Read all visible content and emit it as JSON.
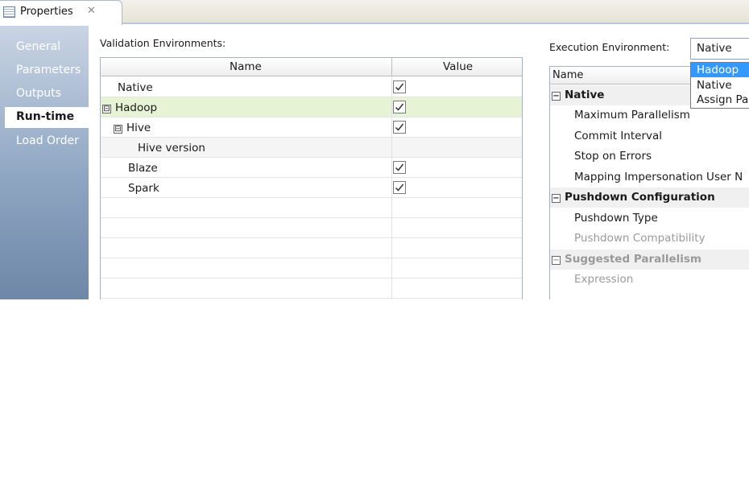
{
  "tab": {
    "title": "Properties",
    "close_glyph": "✕"
  },
  "nav": {
    "items": [
      {
        "label": "General",
        "active": false
      },
      {
        "label": "Parameters",
        "active": false
      },
      {
        "label": "Outputs",
        "active": false
      },
      {
        "label": "Run-time",
        "active": true
      },
      {
        "label": "Load Order",
        "active": false
      }
    ]
  },
  "validation": {
    "label": "Validation Environments:",
    "columns": [
      "Name",
      "Value"
    ],
    "rows": [
      {
        "name": "Native",
        "checked": true
      },
      {
        "name": "Hadoop",
        "checked": true,
        "expander": "⊟"
      },
      {
        "name": "Hive",
        "checked": true,
        "expander": "⊟"
      },
      {
        "name": "Hive version",
        "checked": false
      },
      {
        "name": "Blaze",
        "checked": true
      },
      {
        "name": "Spark",
        "checked": true
      }
    ]
  },
  "execution": {
    "label": "Execution Environment:",
    "selected": "Native",
    "dropdown_options": [
      "Hadoop",
      "Native",
      "Assign Pa"
    ],
    "highlighted_option": "Hadoop",
    "table_header": "Name",
    "rows": [
      {
        "name": "Native",
        "type": "group"
      },
      {
        "name": "Maximum Parallelism",
        "type": "item"
      },
      {
        "name": "Commit Interval",
        "type": "item"
      },
      {
        "name": "Stop on Errors",
        "type": "item"
      },
      {
        "name": "Mapping Impersonation User N",
        "type": "item"
      },
      {
        "name": "Pushdown Configuration",
        "type": "group"
      },
      {
        "name": "Pushdown Type",
        "type": "item"
      },
      {
        "name": "Pushdown Compatibility",
        "type": "disabled"
      },
      {
        "name": "Suggested Parallelism",
        "type": "group-disabled"
      },
      {
        "name": "Expression",
        "type": "disabled"
      }
    ]
  },
  "colors": {
    "highlight_row": "#e6f3d5",
    "dropdown_selection": "#3399ff",
    "nav_gradient_top": "#c9d4e4",
    "nav_gradient_bottom": "#6e87a8"
  }
}
